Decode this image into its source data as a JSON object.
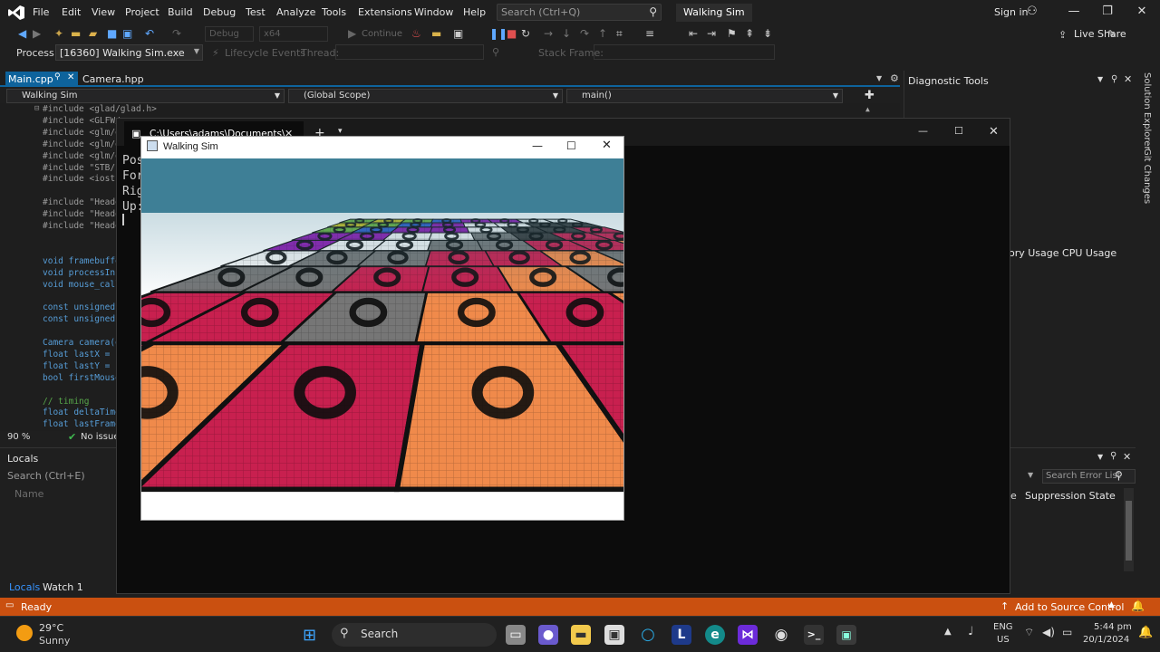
{
  "menu": {
    "items": [
      "File",
      "Edit",
      "View",
      "Project",
      "Build",
      "Debug",
      "Test",
      "Analyze",
      "Tools",
      "Extensions",
      "Window",
      "Help"
    ],
    "search_placeholder": "Search (Ctrl+Q)",
    "solution_name": "Walking Sim",
    "sign_in": "Sign in"
  },
  "toolbar": {
    "config": "Debug",
    "platform": "x64",
    "continue_label": "Continue",
    "live_share": "Live Share"
  },
  "process_bar": {
    "label": "Process:",
    "process_value": "[16360] Walking Sim.exe",
    "lifecycle": "Lifecycle Events",
    "thread": "Thread:",
    "stack_frame": "Stack Frame:"
  },
  "tabs": [
    "Main.cpp",
    "Camera.hpp"
  ],
  "nav": {
    "project": "Walking Sim",
    "scope": "(Global Scope)",
    "function": "main()"
  },
  "code_lines": [
    [
      "#include <glad/glad.h>",
      "pre"
    ],
    [
      "#include <GLFW/",
      "pre"
    ],
    [
      "#include <glm/g",
      "pre"
    ],
    [
      "#include <glm/g",
      "pre"
    ],
    [
      "#include <glm/g",
      "pre"
    ],
    [
      "#include \"STB/s",
      "pre"
    ],
    [
      "#include <iostr",
      "pre"
    ],
    [
      "",
      ""
    ],
    [
      "#include \"Heade",
      "pre"
    ],
    [
      "#include \"Heade",
      "pre"
    ],
    [
      "#include \"Heade",
      "pre"
    ],
    [
      "",
      ""
    ],
    [
      "",
      ""
    ],
    [
      "void framebuffe",
      "code"
    ],
    [
      "void processInp",
      "code"
    ],
    [
      "void mouse_call",
      "code"
    ],
    [
      "",
      ""
    ],
    [
      "const unsigned",
      "code"
    ],
    [
      "const unsigned",
      "code"
    ],
    [
      "",
      ""
    ],
    [
      "Camera camera(g",
      "code"
    ],
    [
      "float lastX = s",
      "code"
    ],
    [
      "float lastY = s",
      "code"
    ],
    [
      "bool firstMouse",
      "code"
    ],
    [
      "",
      ""
    ],
    [
      "// timing",
      "cmt"
    ],
    [
      "float deltaTime",
      "code"
    ],
    [
      "float lastFrame",
      "code"
    ]
  ],
  "editor_status": {
    "zoom": "90 %",
    "issues": "No issues"
  },
  "diagnostic": {
    "title": "Diagnostic Tools",
    "tabs": "ory Usage   CPU Usage"
  },
  "right_sidebar": [
    "Solution Explorer",
    "Git Changes"
  ],
  "locals": {
    "title": "Locals",
    "search_placeholder": "Search (Ctrl+E)",
    "column_name": "Name",
    "error_search": "Search Error List",
    "col_e": "e",
    "col_suppression": "Suppression State",
    "bottom_tabs": [
      "Locals",
      "Watch 1"
    ]
  },
  "status": {
    "ready": "Ready",
    "source_control": "Add to Source Control"
  },
  "console": {
    "tab_title": "C:\\Users\\adams\\Documents\\",
    "lines": [
      "Pos",
      "For",
      "Rig",
      "Up:"
    ]
  },
  "game_window": {
    "title": "Walking Sim"
  },
  "taskbar": {
    "temperature": "29°C",
    "weather": "Sunny",
    "search_label": "Search",
    "language": "ENG",
    "region": "US",
    "time": "5:44 pm",
    "date": "20/1/2024"
  },
  "colors": {
    "accent": "#0e639c",
    "status_bar": "#ca5010",
    "tile_pink": "#c8204f",
    "tile_orange": "#f08a4b",
    "tile_gray": "#767676",
    "tile_purple": "#8e1bb0",
    "sky": "#3e7f96"
  }
}
